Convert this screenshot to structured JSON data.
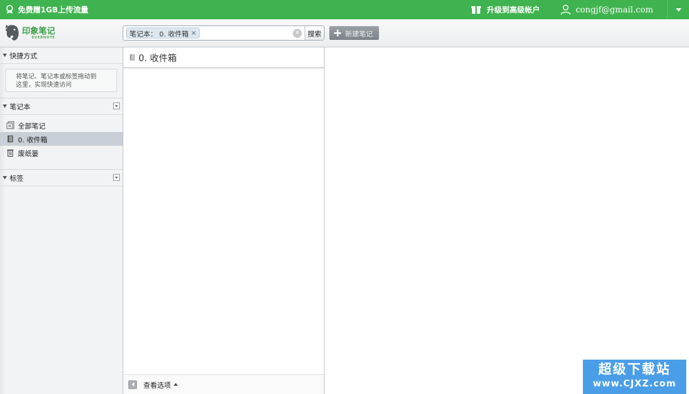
{
  "topbar": {
    "promo_text": "免费赠1GB上传流量",
    "upgrade_text": "升级到高级帐户",
    "account_email": "congjf@gmail.com",
    "bg_color": "#3fb34f"
  },
  "toolbar": {
    "logo_cn": "印象笔记",
    "logo_en": "EVERNOTE",
    "search_tag": "笔记本：  0. 收件箱",
    "search_tag_close": "×",
    "search_clear": "×",
    "search_button": "搜索",
    "new_note_label": "新建笔记"
  },
  "sidebar": {
    "shortcuts_title": "快捷方式",
    "shortcuts_hint_line1": "将笔记、笔记本或标签拖动到",
    "shortcuts_hint_line2": "这里，实现快速访问",
    "notebooks_title": "笔记本",
    "notebooks": [
      {
        "label": "全部笔记",
        "icon": "all-notes-icon"
      },
      {
        "label": "0. 收件箱",
        "icon": "notebook-icon",
        "selected": true
      },
      {
        "label": "废纸篓",
        "icon": "trash-icon"
      }
    ],
    "tags_title": "标签"
  },
  "note_list": {
    "title": "0. 收件箱",
    "view_options": "查看选项"
  },
  "watermark": {
    "line1": "超级下载站",
    "line2": "www.CJXZ.com"
  }
}
